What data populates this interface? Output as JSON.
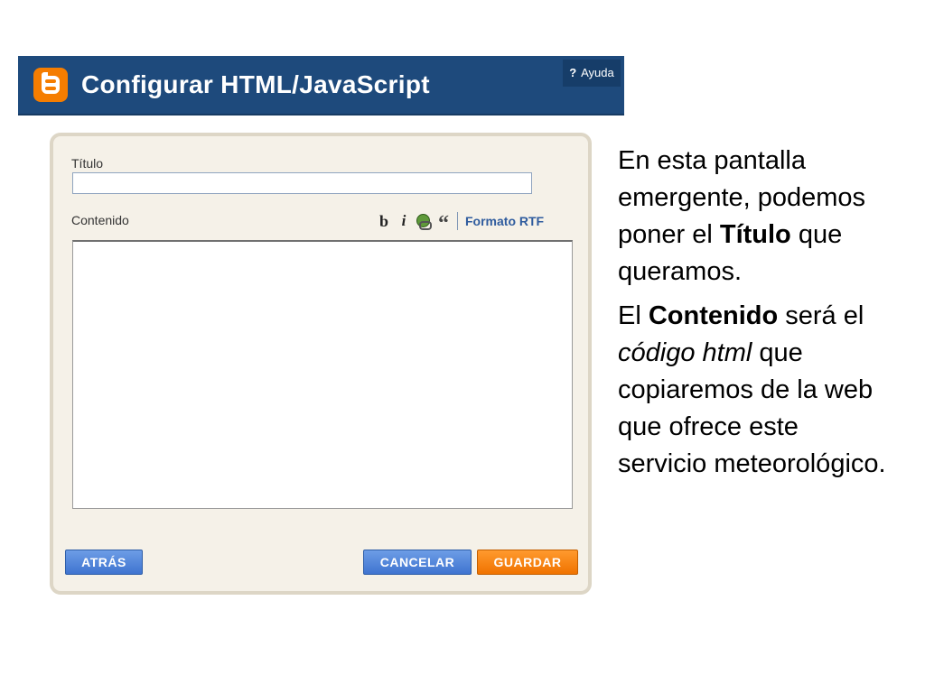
{
  "header": {
    "title": "Configurar HTML/JavaScript",
    "help_label": "Ayuda",
    "help_icon": "?",
    "logo_icon": "blogger-logo",
    "bg_color": "#1e4a7c",
    "logo_color": "#f57d00"
  },
  "form": {
    "titulo_label": "Título",
    "titulo_value": "",
    "contenido_label": "Contenido",
    "contenido_value": "",
    "toolbar": {
      "bold": "b",
      "italic": "i",
      "link_icon": "link-icon",
      "quote": "“",
      "rich_text": "Formato RTF"
    }
  },
  "buttons": {
    "back": "ATRÁS",
    "cancel": "CANCELAR",
    "save": "GUARDAR"
  },
  "explanation": {
    "p1_a": "En esta pantalla emergente, podemos poner el ",
    "p1_bold": "Título",
    "p1_b": " que queramos.",
    "p2_a": "El ",
    "p2_bold": "Contenido",
    "p2_b": " será el ",
    "p2_italic": "código html",
    "p2_c": " que copiaremos de la web que ofrece este servicio meteorológico."
  }
}
